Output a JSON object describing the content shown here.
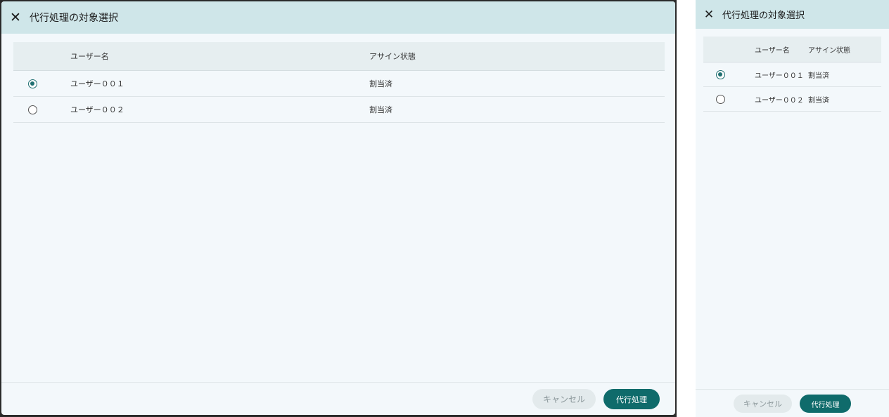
{
  "dialog": {
    "title": "代行処理の対象選択",
    "close_icon": "close-icon",
    "columns": {
      "user_name": "ユーザー名",
      "assign_status": "アサイン状態"
    },
    "rows": [
      {
        "user_name": "ユーザー００１",
        "status": "割当済",
        "selected": true
      },
      {
        "user_name": "ユーザー００２",
        "status": "割当済",
        "selected": false
      }
    ],
    "buttons": {
      "cancel": "キャンセル",
      "proxy": "代行処理"
    }
  },
  "colors": {
    "header_bg": "#cfe6e9",
    "body_bg": "#f3f8fb",
    "primary": "#0f6b6b",
    "cancel_bg": "#e3eaec"
  }
}
